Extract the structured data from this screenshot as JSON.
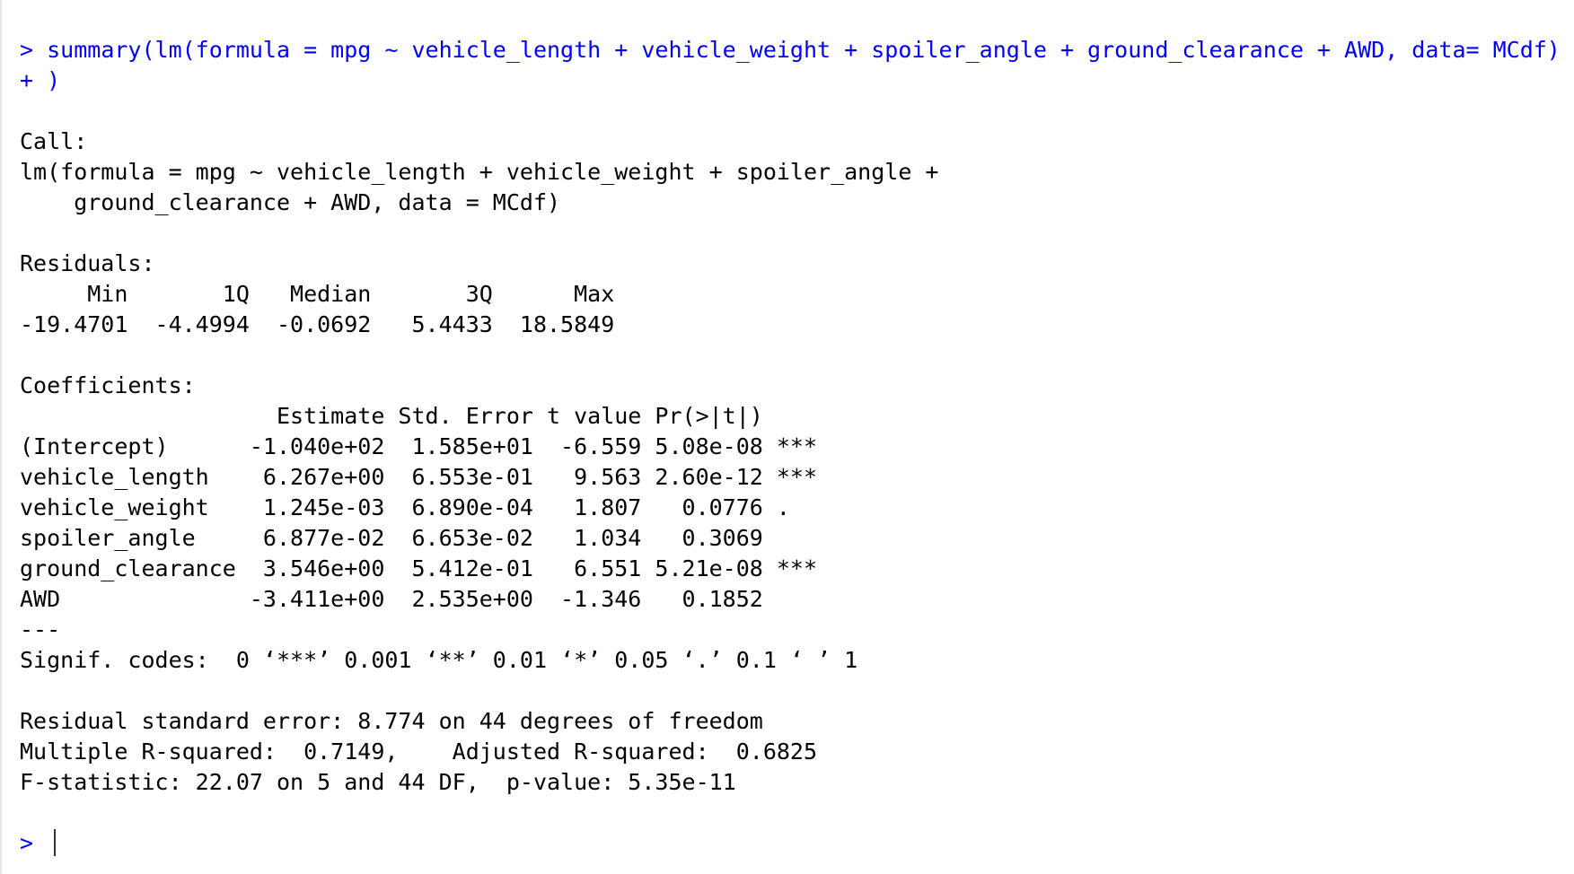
{
  "console": {
    "command": {
      "prompt": "> ",
      "text": "summary(lm(formula = mpg ~ vehicle_length + vehicle_weight + spoiler_angle + ground_clearance + AWD, data= MCdf)",
      "continuation_prompt": "+ ",
      "continuation_text": ")"
    },
    "output_lines": [
      "",
      "Call:",
      "lm(formula = mpg ~ vehicle_length + vehicle_weight + spoiler_angle + ",
      "    ground_clearance + AWD, data = MCdf)",
      "",
      "Residuals:",
      "     Min       1Q   Median       3Q      Max ",
      "-19.4701  -4.4994  -0.0692   5.4433  18.5849 ",
      "",
      "Coefficients:",
      "                   Estimate Std. Error t value Pr(>|t|)    ",
      "(Intercept)      -1.040e+02  1.585e+01  -6.559 5.08e-08 ***",
      "vehicle_length    6.267e+00  6.553e-01   9.563 2.60e-12 ***",
      "vehicle_weight    1.245e-03  6.890e-04   1.807   0.0776 .  ",
      "spoiler_angle     6.877e-02  6.653e-02   1.034   0.3069    ",
      "ground_clearance  3.546e+00  5.412e-01   6.551 5.21e-08 ***",
      "AWD              -3.411e+00  2.535e+00  -1.346   0.1852    ",
      "---",
      "Signif. codes:  0 ‘***’ 0.001 ‘**’ 0.01 ‘*’ 0.05 ‘.’ 0.1 ‘ ’ 1",
      "",
      "Residual standard error: 8.774 on 44 degrees of freedom",
      "Multiple R-squared:  0.7149,\tAdjusted R-squared:  0.6825 ",
      "F-statistic: 22.07 on 5 and 44 DF,  p-value: 5.35e-11",
      ""
    ],
    "final_prompt": "> ",
    "colors": {
      "input": "#0000ff",
      "output": "#000000",
      "background": "#ffffff"
    }
  }
}
